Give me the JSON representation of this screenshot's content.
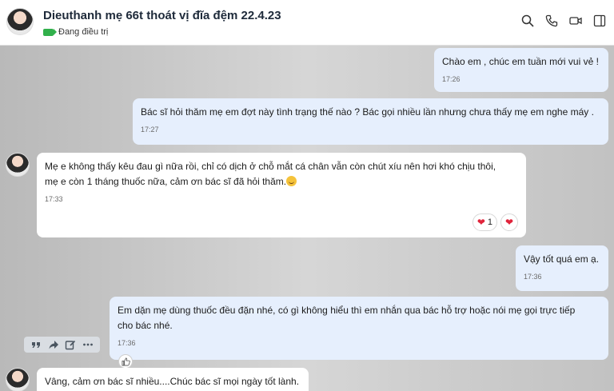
{
  "header": {
    "contact_name": "Dieuthanh mẹ 66t thoát vị đĩa đệm 22.4.23",
    "status_tag": "Đang điều trị",
    "icons": [
      "search-icon",
      "phone-icon",
      "video-call-icon",
      "sidebar-toggle-icon"
    ]
  },
  "messages": [
    {
      "from": "me",
      "text": "Chào em , chúc em tuần mới vui vẻ !",
      "time": "17:26"
    },
    {
      "from": "me",
      "text": "Bác sĩ hỏi thăm mẹ em đợt này tình trạng thế nào ? Bác gọi nhiều lần nhưng chưa thấy mẹ em nghe máy .",
      "time": "17:27"
    },
    {
      "from": "them",
      "line1": "Mẹ e không thấy kêu đau gì nữa rồi, chỉ có dịch ở chỗ mắt cá chân vẫn còn chút xíu nên hơi khó chịu thôi,",
      "line2": "mẹ e còn 1 tháng thuốc nữa, cảm ơn bác sĩ đã hỏi thăm.",
      "emoji": "grinning-face-emoji",
      "time": "17:33",
      "reaction_count": "1"
    },
    {
      "from": "me",
      "text": "Vậy tốt quá em ạ.",
      "time": "17:36"
    },
    {
      "from": "me",
      "line1": "Em dặn mẹ dùng thuốc đều đặn nhé, có gì không hiểu thì em nhắn qua bác hỗ trợ hoặc nói mẹ gọi trực tiếp",
      "line2": "cho bác nhé.",
      "time": "17:36"
    },
    {
      "from": "them",
      "text": "Vâng, cảm ơn bác sĩ nhiều....Chúc bác sĩ mọi ngày tốt lành."
    }
  ],
  "hover_tools": [
    "quote-icon",
    "forward-icon",
    "edit-icon",
    "more-icon"
  ],
  "colors": {
    "my_bubble": "#e6effd",
    "their_bubble": "#ffffff",
    "status_tag": "#31b04b",
    "heart": "#e0243b"
  }
}
